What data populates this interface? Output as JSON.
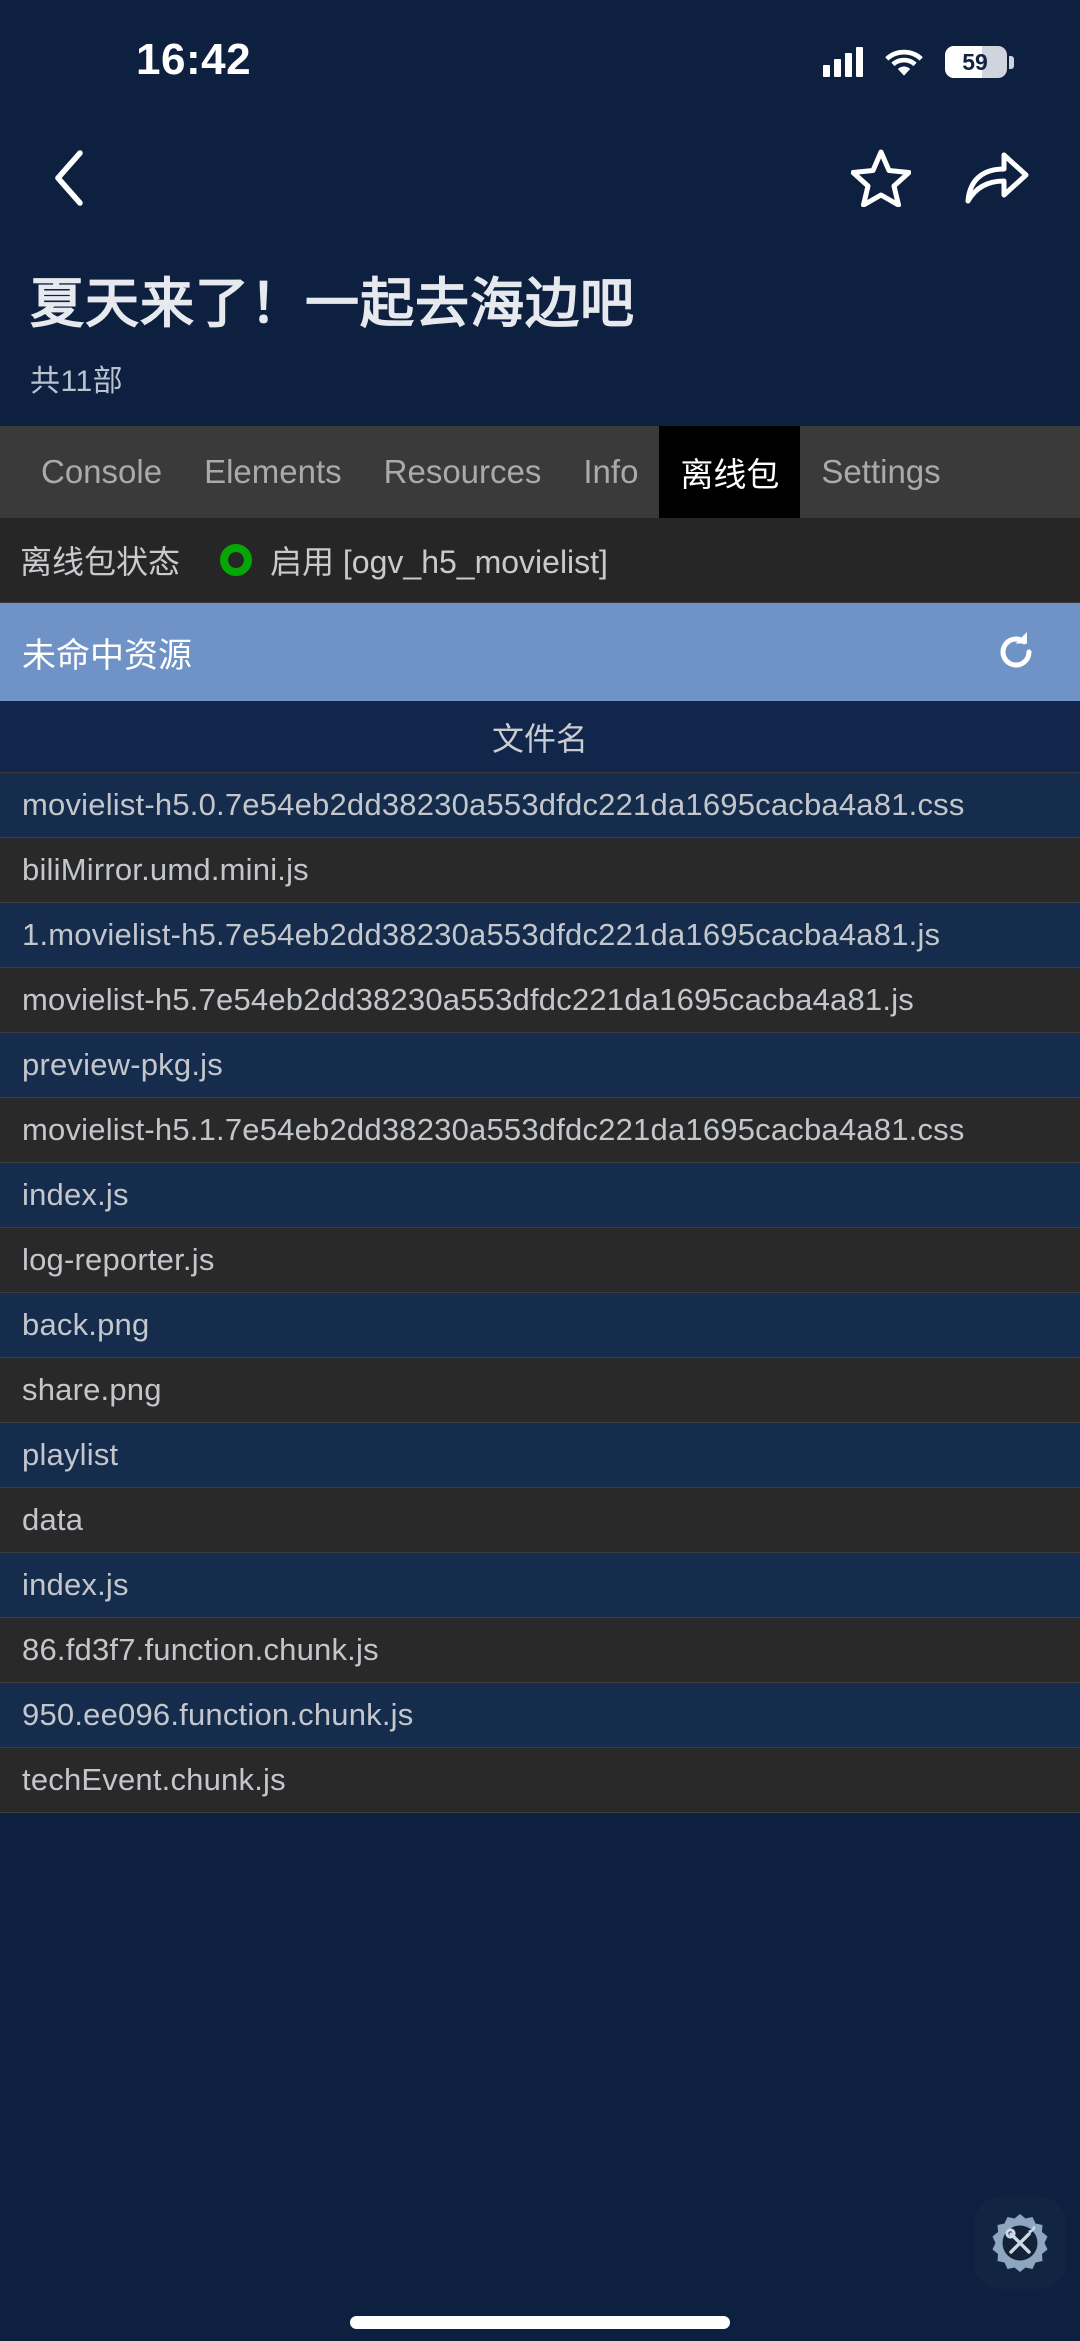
{
  "status_bar": {
    "time": "16:42",
    "signal_icon": "cellular-signal-icon",
    "wifi_icon": "wifi-icon",
    "battery_percent": "59",
    "battery_level": 59
  },
  "app_nav": {
    "back_icon": "back-chevron-icon",
    "favorite_icon": "star-icon",
    "share_icon": "share-arrow-icon"
  },
  "header": {
    "title": "夏天来了！一起去海边吧",
    "subtitle": "共11部"
  },
  "devtools": {
    "tabs": [
      {
        "label": "Console",
        "active": false
      },
      {
        "label": "Elements",
        "active": false
      },
      {
        "label": "Resources",
        "active": false
      },
      {
        "label": "Info",
        "active": false
      },
      {
        "label": "离线包",
        "active": true
      },
      {
        "label": "Settings",
        "active": false
      }
    ],
    "status_row": {
      "label": "离线包状态",
      "indicator_icon": "green-circle-status-icon",
      "indicator_color": "#05a705",
      "value": "启用 [ogv_h5_movielist]"
    },
    "section": {
      "title": "未命中资源",
      "refresh_icon": "refresh-icon"
    },
    "table": {
      "columns": [
        "文件名"
      ],
      "rows": [
        "movielist-h5.0.7e54eb2dd38230a553dfdc221da1695cacba4a81.css",
        "biliMirror.umd.mini.js",
        "1.movielist-h5.7e54eb2dd38230a553dfdc221da1695cacba4a81.js",
        "movielist-h5.7e54eb2dd38230a553dfdc221da1695cacba4a81.js",
        "preview-pkg.js",
        "movielist-h5.1.7e54eb2dd38230a553dfdc221da1695cacba4a81.css",
        "index.js",
        "log-reporter.js",
        "back.png",
        "share.png",
        "playlist",
        "data",
        "index.js",
        "86.fd3f7.function.chunk.js",
        "950.ee096.function.chunk.js",
        "techEvent.chunk.js"
      ]
    },
    "floating_button_icon": "devtools-gear-tools-icon"
  },
  "system": {
    "home_indicator": "home-indicator"
  },
  "colors": {
    "page_background": "#0d2040",
    "row_navy": "#152c4c",
    "row_gray": "#292929",
    "section_blue": "#6f93c6",
    "tab_bar": "#3a3a3a",
    "tab_active": "#000000",
    "status_green": "#05a705"
  }
}
